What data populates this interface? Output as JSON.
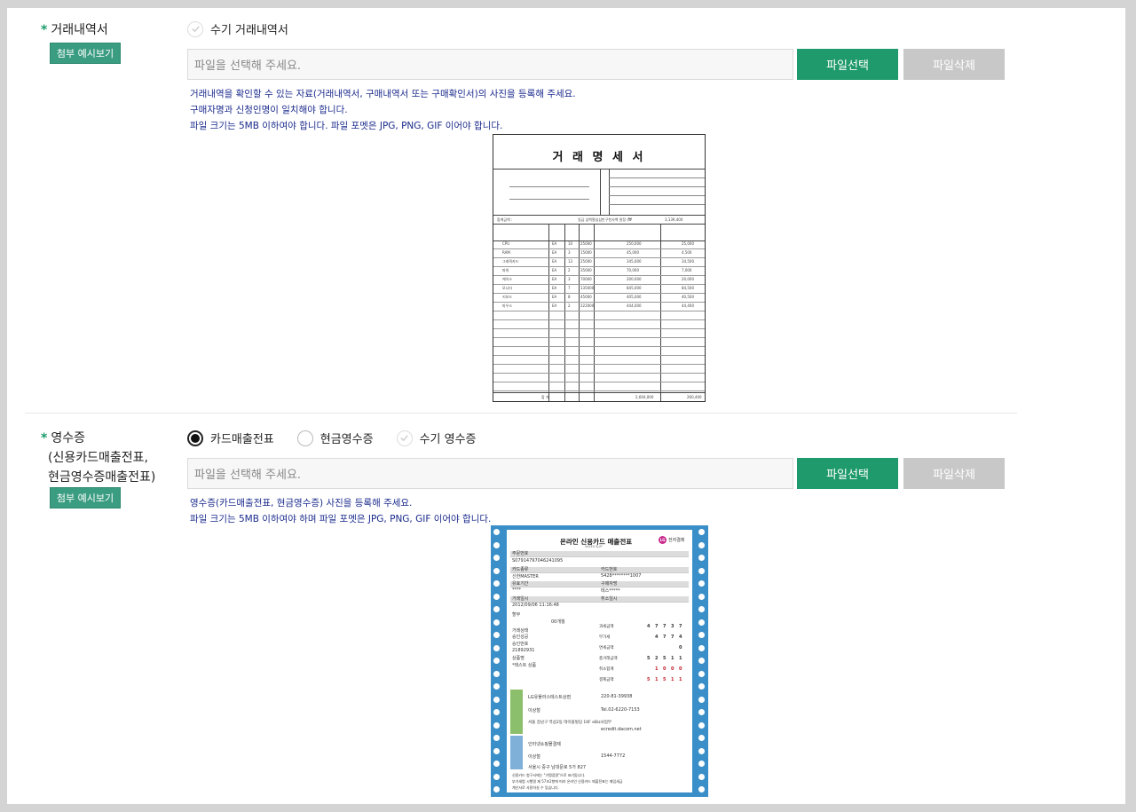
{
  "section1": {
    "label": "거래내역서",
    "required_mark": "*",
    "example_button": "첨부 예시보기",
    "option": "수기 거래내역서",
    "file_placeholder": "파일을 선택해 주세요.",
    "select_button": "파일선택",
    "delete_button": "파일삭제",
    "guide": [
      "거래내역을 확인할 수 있는 자료(거래내역서, 구매내역서 또는 구매확인서)의 사진을 등록해 주세요.",
      "구매자명과 신청인명이 일치해야 합니다.",
      "파일 크기는 5MB 이하여야 합니다. 파일 포멧은 JPG, PNG, GIF 이어야 합니다."
    ],
    "sample": {
      "title": "거 래 명 세 서",
      "total_label": "합계금액 :",
      "total_text": "일금 삼백팔십삼만구천사백 원정 (₩",
      "total_value": "3,139,400",
      "rows": [
        {
          "name": "CPU",
          "unit": "EA",
          "qty": "10",
          "price": "25000",
          "supply": "250,000",
          "tax": "25,000"
        },
        {
          "name": "RAM",
          "unit": "EA",
          "qty": "3",
          "price": "15000",
          "supply": "45,000",
          "tax": "4,500"
        },
        {
          "name": "그래픽카드",
          "unit": "EA",
          "qty": "13",
          "price": "25000",
          "supply": "345,000",
          "tax": "34,500"
        },
        {
          "name": "파워",
          "unit": "EA",
          "qty": "2",
          "price": "35000",
          "supply": "70,000",
          "tax": "7,000"
        },
        {
          "name": "케이스",
          "unit": "EA",
          "qty": "3",
          "price": "70000",
          "supply": "200,000",
          "tax": "20,000"
        },
        {
          "name": "모니터",
          "unit": "EA",
          "qty": "7",
          "price": "135000",
          "supply": "845,000",
          "tax": "84,500"
        },
        {
          "name": "키보드",
          "unit": "EA",
          "qty": "8",
          "price": "45000",
          "supply": "405,000",
          "tax": "40,500"
        },
        {
          "name": "마우스",
          "unit": "EA",
          "qty": "2",
          "price": "222000",
          "supply": "444,000",
          "tax": "44,400"
        }
      ],
      "sum_label": "합 계",
      "sum_supply": "2,604,000",
      "sum_tax": "260,400"
    }
  },
  "section2": {
    "required_mark": "*",
    "label_lines": [
      "영수증",
      "(신용카드매출전표,",
      "현금영수증매출전표)"
    ],
    "example_button": "첨부 예시보기",
    "options": [
      "카드매출전표",
      "현금영수증",
      "수기 영수증"
    ],
    "file_placeholder": "파일을 선택해 주세요.",
    "select_button": "파일선택",
    "delete_button": "파일삭제",
    "guide": [
      "영수증(카드매출전표, 현금영수증) 사진을 등록해 주세요.",
      "파일 크기는 5MB 이하여야 하며 파일 포멧은 JPG, PNG, GIF 이어야 합니다."
    ],
    "sample": {
      "title": "온라인 신용카드 매출전표",
      "subtitle": "SALES SLIP",
      "logo": "전자결제",
      "order_label": "주문번호",
      "order_no": "S07914797046241095",
      "card_type_label": "카드종류",
      "card_type": "신한MASTER",
      "card_no_label": "카드번호",
      "card_no": "5428********1007",
      "expiry_label": "유효기간",
      "expiry": "****",
      "buyer_label": "구매자명",
      "buyer": "테스*****",
      "trade_date_label": "거래일시",
      "trade_date": "2012/09/06 11:16:48",
      "cancel_date_label": "취소일시",
      "install_label": "할부",
      "installment": "00개월",
      "status_label": "거래상태",
      "status": "승인성공",
      "approval_label": "승인번호",
      "approval_no": "21892931",
      "product_label": "상품명",
      "product": "*테스트 상품",
      "merchant": "LG유플러스테스트상점",
      "biz_no": "220-81-39938",
      "tel": "Tel.02-6220-7153",
      "merchant_addr": "서울 강남구 역삼2동 테이블빌딩 10F eBiz사업부",
      "url": "ecredit.dacom.net",
      "rep": "이상철",
      "pg_name": "인터넷쇼핑몰결제",
      "pg_phone": "1544-7772",
      "pg_rep": "이상철",
      "pg_addr": "서울시 중구 남대문로 5가 827",
      "footer1": "신용카드 청구서에는 \"가맹점명\"으로 표기됩니다.",
      "footer2": "부가세법 시행령 제 57조2항에 따라 온라인 신용카드 매출전표는 매입세금",
      "footer3": "계산서로 사용하실 수 있습니다.",
      "amount_rows": [
        {
          "label": "과세금액",
          "digits": [
            "4",
            "7",
            "7",
            "3",
            "7"
          ]
        },
        {
          "label": "부가세",
          "digits": [
            "",
            "4",
            "7",
            "7",
            "4"
          ]
        },
        {
          "label": "면세금액",
          "digits": [
            "",
            "",
            "",
            "",
            "0"
          ]
        },
        {
          "label": "총거래금액",
          "digits": [
            "5",
            "2",
            "5",
            "1",
            "1"
          ]
        },
        {
          "label": "취소합계",
          "digits": [
            "",
            "1",
            "0",
            "0",
            "0"
          ]
        },
        {
          "label": "결제금액",
          "digits": [
            "5",
            "1",
            "5",
            "1",
            "1"
          ]
        }
      ]
    }
  }
}
